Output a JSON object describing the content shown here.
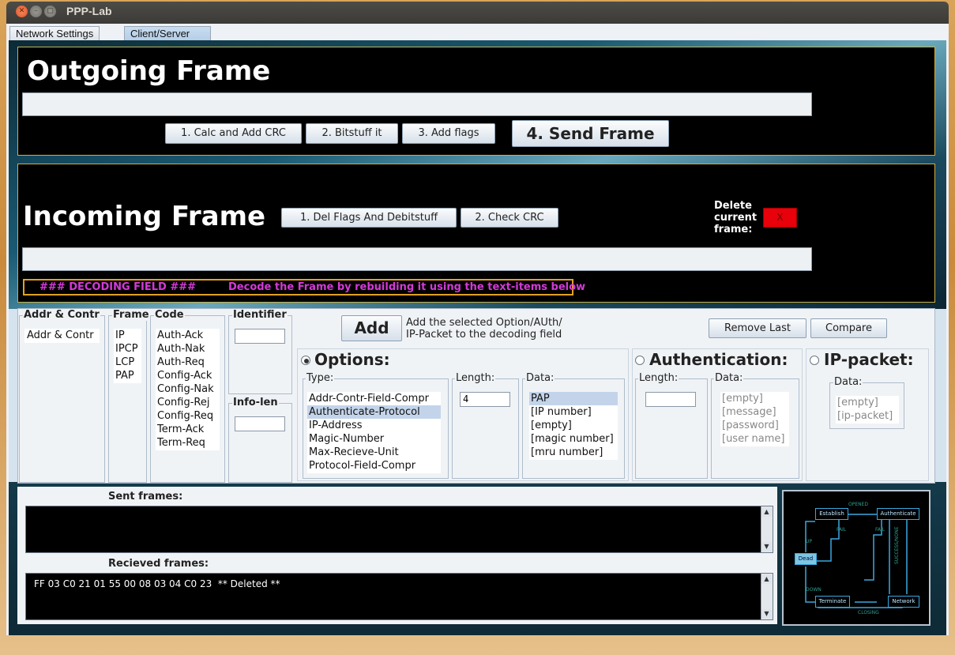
{
  "window": {
    "title": "PPP-Lab",
    "close_glyph": "✕",
    "min_glyph": "–",
    "max_glyph": "▢"
  },
  "tabs": [
    {
      "label": "Network Settings"
    },
    {
      "label": "Client/Server"
    }
  ],
  "outgoing": {
    "title": "Outgoing Frame",
    "value": "",
    "buttons": {
      "crc": "1. Calc and Add CRC",
      "bitstuff": "2. Bitstuff it",
      "flags": "3. Add flags",
      "send": "4. Send Frame"
    }
  },
  "incoming": {
    "title": "Incoming Frame",
    "buttons": {
      "delflags": "1. Del Flags And Debitstuff",
      "checkcrc": "2. Check CRC"
    },
    "delete_label": "Delete current frame:",
    "delete_button": "X",
    "value": "",
    "decode_tag": "###  DECODING FIELD ###",
    "decode_hint": "Decode the Frame by rebuilding it using the text-items below"
  },
  "editor": {
    "addr": {
      "label": "Addr & Contr",
      "items": [
        "Addr & Contr"
      ]
    },
    "frame": {
      "label": "Frame",
      "items": [
        "IP",
        "IPCP",
        "LCP",
        "PAP"
      ]
    },
    "code": {
      "label": "Code",
      "items": [
        "Auth-Ack",
        "Auth-Nak",
        "Auth-Req",
        "Config-Ack",
        "Config-Nak",
        "Config-Rej",
        "Config-Req",
        "Term-Ack",
        "Term-Req"
      ]
    },
    "identifier": {
      "label": "Identifier",
      "value": ""
    },
    "infolen": {
      "label": "Info-len",
      "value": ""
    },
    "add_button": "Add",
    "add_desc": [
      "Add the selected Option/AUth/",
      "IP-Packet to the decoding field"
    ],
    "remove_last": "Remove Last",
    "compare": "Compare",
    "options": {
      "title": "Options:",
      "selected": true,
      "type_label": "Type:",
      "types": [
        "Addr-Contr-Field-Compr",
        "Authenticate-Protocol",
        "IP-Address",
        "Magic-Number",
        "Max-Recieve-Unit",
        "Protocol-Field-Compr"
      ],
      "selected_type": "Authenticate-Protocol",
      "length_label": "Length:",
      "length_value": "4",
      "data_label": "Data:",
      "data": [
        "PAP",
        "[IP number]",
        "[empty]",
        "[magic number]",
        "[mru number]"
      ],
      "selected_data": "PAP"
    },
    "authentication": {
      "title": "Authentication:",
      "selected": false,
      "length_label": "Length:",
      "length_value": "",
      "data_label": "Data:",
      "data": [
        "[empty]",
        "[message]",
        "[password]",
        "[user name]"
      ]
    },
    "ip_packet": {
      "title": "IP-packet:",
      "selected": false,
      "data_label": "Data:",
      "data": [
        "[empty]",
        "[ip-packet]"
      ]
    }
  },
  "console": {
    "sent_label": "Sent frames:",
    "sent_text": "",
    "recv_label": "Recieved frames:",
    "recv_text": "FF 03 C0 21 01 55 00 08 03 04 C0 23  ** Deleted **",
    "scroll_up": "▲",
    "scroll_down": "▼"
  },
  "diagram": {
    "nodes": {
      "dead": "Dead",
      "establish": "Establish",
      "authenticate": "Authenticate",
      "network": "Network",
      "terminate": "Terminate"
    },
    "edges": {
      "opened": "OPENED",
      "fail1": "FAIL",
      "fail2": "FAIL",
      "up": "UP",
      "down": "DOWN",
      "closing": "CLOSING",
      "success": "SUCCESS/NONE"
    }
  }
}
